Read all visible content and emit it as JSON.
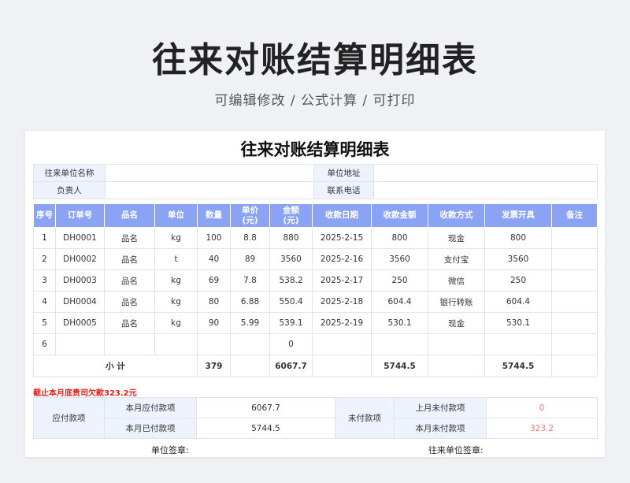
{
  "hero": {
    "title": "往来对账结算明细表",
    "subtitle": "可编辑修改 /  公式计算  /  可打印"
  },
  "sheet_title": "往来对账结算明细表",
  "info": {
    "company_label": "往来单位名称",
    "address_label": "单位地址",
    "manager_label": "负责人",
    "phone_label": "联系电话"
  },
  "columns": [
    "序号",
    "订单号",
    "品名",
    "单位",
    "数量",
    "单价\n(元)",
    "金额\n(元)",
    "收款日期",
    "收款金额",
    "收款方式",
    "发票开具",
    "备注"
  ],
  "rows": [
    [
      "1",
      "DH0001",
      "品名",
      "kg",
      "100",
      "8.8",
      "880",
      "2025-2-15",
      "800",
      "现金",
      "800",
      ""
    ],
    [
      "2",
      "DH0002",
      "品名",
      "t",
      "40",
      "89",
      "3560",
      "2025-2-16",
      "3560",
      "支付宝",
      "3560",
      ""
    ],
    [
      "3",
      "DH0003",
      "品名",
      "kg",
      "69",
      "7.8",
      "538.2",
      "2025-2-17",
      "250",
      "微信",
      "250",
      ""
    ],
    [
      "4",
      "DH0004",
      "品名",
      "kg",
      "80",
      "6.88",
      "550.4",
      "2025-2-18",
      "604.4",
      "银行转账",
      "604.4",
      ""
    ],
    [
      "5",
      "DH0005",
      "品名",
      "kg",
      "90",
      "5.99",
      "539.1",
      "2025-2-19",
      "530.1",
      "现金",
      "530.1",
      ""
    ],
    [
      "6",
      "",
      "",
      "",
      "",
      "",
      "0",
      "",
      "",
      "",
      "",
      ""
    ]
  ],
  "subtotal": {
    "label": "小    计",
    "qty": "379",
    "amount": "6067.7",
    "received": "5744.5",
    "invoice": "5744.5"
  },
  "warning": "截止本月底贵司欠款323.2元",
  "summary": {
    "payable_label": "应付款项",
    "month_payable_label": "本月应付款项",
    "month_payable": "6067.7",
    "month_paid_label": "本月已付款项",
    "month_paid": "5744.5",
    "unpaid_label": "未付款项",
    "last_unpaid_label": "上月未付款项",
    "last_unpaid": "0",
    "month_unpaid_label": "本月未付款项",
    "month_unpaid": "323.2"
  },
  "signature": {
    "own": "单位签章:",
    "partner": "往来单位签章:"
  }
}
